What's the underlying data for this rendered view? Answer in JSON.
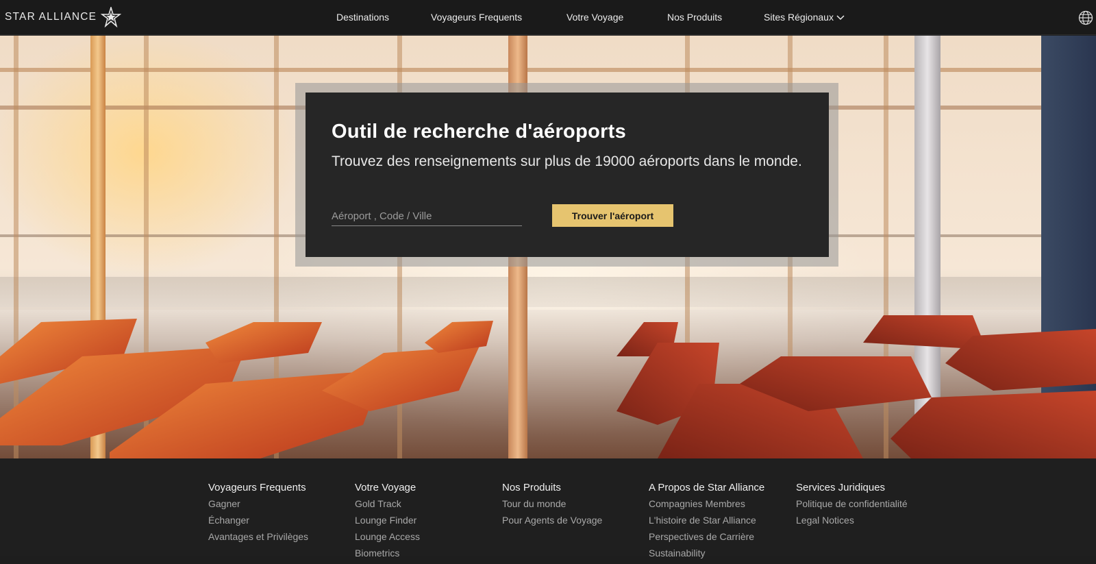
{
  "header": {
    "logo_text": "STAR ALLIANCE",
    "nav": [
      {
        "label": "Destinations"
      },
      {
        "label": "Voyageurs Frequents"
      },
      {
        "label": "Votre Voyage"
      },
      {
        "label": "Nos Produits"
      },
      {
        "label": "Sites Régionaux"
      }
    ],
    "icons": {
      "logo": "star-alliance-logo-icon",
      "dropdown": "chevron-down-icon",
      "language": "globe-icon"
    }
  },
  "search": {
    "title": "Outil de recherche d'aéroports",
    "subtitle": "Trouvez des renseignements sur plus de 19000 aéroports dans le monde.",
    "placeholder": "Aéroport , Code / Ville",
    "value": "",
    "button_label": "Trouver l'aéroport"
  },
  "footer": {
    "columns": [
      {
        "heading": "Voyageurs Frequents",
        "links": [
          "Gagner",
          "Échanger",
          "Avantages et Privilèges"
        ]
      },
      {
        "heading": "Votre Voyage",
        "links": [
          "Gold Track",
          "Lounge Finder",
          "Lounge Access",
          "Biometrics"
        ]
      },
      {
        "heading": "Nos Produits",
        "links": [
          "Tour du monde",
          "Pour Agents de Voyage"
        ]
      },
      {
        "heading": "A Propos de Star Alliance",
        "links": [
          "Compagnies Membres",
          "L'histoire de Star Alliance",
          "Perspectives de Carrière",
          "Sustainability"
        ]
      },
      {
        "heading": "Services Juridiques",
        "links": [
          "Politique de confidentialité",
          "Legal Notices"
        ]
      }
    ]
  },
  "colors": {
    "nav_background": "#1a1a1a",
    "panel_background": "#262626",
    "accent_button": "#e6c46f",
    "footer_background": "#1f1f1f",
    "seat_orange": "#e0552a"
  }
}
